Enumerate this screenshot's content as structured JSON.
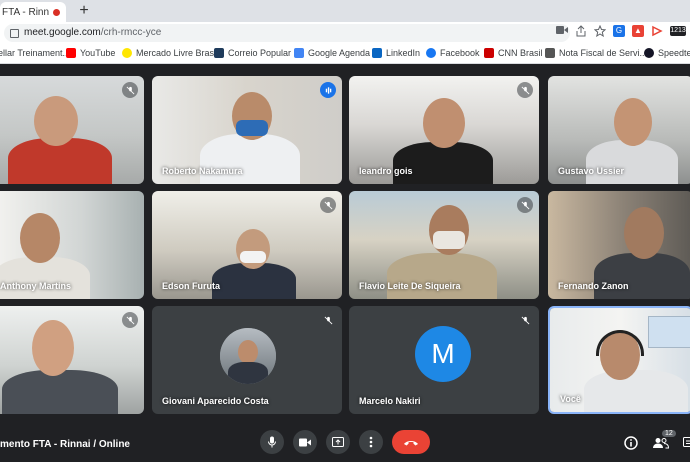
{
  "browser": {
    "tab_title": "FTA - Rinn",
    "tab_close": "×",
    "new_tab": "+",
    "url_host": "meet.google.com",
    "url_path": "/crh-rmcc-yce",
    "badge": "1213"
  },
  "bookmarks": [
    {
      "label": "ellar Treinament...",
      "color": "#9aa0a6"
    },
    {
      "label": "YouTube",
      "color": "#ff0000"
    },
    {
      "label": "Mercado Livre Brasil",
      "color": "#ffe600"
    },
    {
      "label": "Correio Popular",
      "color": "#1f3b5b"
    },
    {
      "label": "Google Agenda",
      "color": "#4285f4"
    },
    {
      "label": "LinkedIn",
      "color": "#0a66c2"
    },
    {
      "label": "Facebook",
      "color": "#1877f2"
    },
    {
      "label": "CNN Brasil",
      "color": "#cc0000"
    },
    {
      "label": "Nota Fiscal de Servi...",
      "color": "#555555"
    },
    {
      "label": "Speedtest",
      "color": "#141526"
    }
  ],
  "participants": [
    {
      "name": "",
      "muted": true
    },
    {
      "name": "Roberto Nakamura",
      "muted": false,
      "speaking": true
    },
    {
      "name": "leandro gois",
      "muted": true
    },
    {
      "name": "Gustavo Ussier",
      "muted": false
    },
    {
      "name": "Anthony Martins",
      "muted": false
    },
    {
      "name": "Edson Furuta",
      "muted": true
    },
    {
      "name": "Flavio Leite De Siqueira",
      "muted": true
    },
    {
      "name": "Fernando Zanon",
      "muted": false
    },
    {
      "name": "",
      "muted": true
    },
    {
      "name": "Giovani Aparecido Costa",
      "muted": true
    },
    {
      "name": "Marcelo Nakiri",
      "muted": true,
      "avatar_letter": "M"
    },
    {
      "name": "Você",
      "muted": false
    }
  ],
  "meeting": {
    "title": "mento FTA - Rinnai / Online",
    "participant_count": "12"
  },
  "colors": {
    "meet_bg": "#202124",
    "end_call": "#ea4335",
    "accent": "#1a73e8"
  }
}
